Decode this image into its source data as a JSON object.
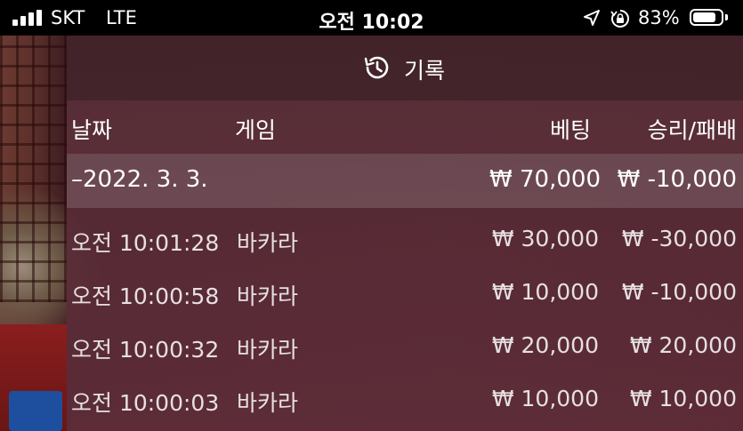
{
  "status_bar": {
    "carrier": "SKT",
    "network": "LTE",
    "time": "오전 10:02",
    "battery_percent": "83%",
    "battery_level": 0.83,
    "icons": [
      "signal-icon",
      "location-icon",
      "rotation-lock-icon",
      "battery-icon"
    ]
  },
  "panel": {
    "title": "기록",
    "title_icon": "history-icon",
    "columns": {
      "date": "날짜",
      "game": "게임",
      "bet": "베팅",
      "result": "승리/패배"
    },
    "date_group": {
      "label": "–2022. 3. 3.",
      "total_bet": "₩ 70,000",
      "total_result": "₩ -10,000"
    },
    "rows": [
      {
        "time": "오전 10:01:28",
        "game": "바카라",
        "bet": "₩ 30,000",
        "result": "₩ -30,000"
      },
      {
        "time": "오전 10:00:58",
        "game": "바카라",
        "bet": "₩ 10,000",
        "result": "₩ -10,000"
      },
      {
        "time": "오전 10:00:32",
        "game": "바카라",
        "bet": "₩ 20,000",
        "result": "₩ 20,000"
      },
      {
        "time": "오전 10:00:03",
        "game": "바카라",
        "bet": "₩ 10,000",
        "result": "₩ 10,000"
      }
    ]
  },
  "colors": {
    "status_bar_bg": "#000000",
    "panel_bg": "#58303a",
    "text": "#ffffff"
  }
}
